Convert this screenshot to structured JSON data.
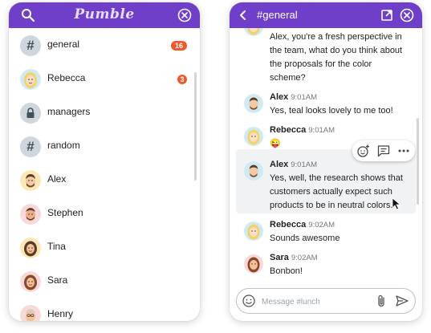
{
  "left_panel": {
    "logo": "Pumble",
    "icons": {
      "search": "search-icon",
      "close": "close-circle-icon"
    },
    "rows": [
      {
        "label": "general",
        "type": "channel",
        "icon": "hash-icon",
        "badge": "16"
      },
      {
        "label": "Rebecca",
        "type": "dm",
        "icon": "avatar-rebecca",
        "badge": "3"
      },
      {
        "label": "managers",
        "type": "channel",
        "icon": "lock-icon",
        "badge": ""
      },
      {
        "label": "random",
        "type": "channel",
        "icon": "hash-icon",
        "badge": ""
      },
      {
        "label": "Alex",
        "type": "dm",
        "icon": "avatar-alex",
        "badge": ""
      },
      {
        "label": "Stephen",
        "type": "dm",
        "icon": "avatar-stephen",
        "badge": ""
      },
      {
        "label": "Tina",
        "type": "dm",
        "icon": "avatar-tina",
        "badge": ""
      },
      {
        "label": "Sara",
        "type": "dm",
        "icon": "avatar-sara",
        "badge": ""
      },
      {
        "label": "Henry",
        "type": "dm",
        "icon": "avatar-henry",
        "badge": ""
      }
    ]
  },
  "chat": {
    "title": "#general",
    "icons": {
      "back": "chevron-left-icon",
      "popout": "popout-icon",
      "close": "close-circle-icon"
    },
    "messages": [
      {
        "author": "",
        "time": "",
        "lines": [
          "Alex, you're a fresh perspective in",
          "the team, what do you think about",
          "the proposals for the color",
          "scheme?"
        ]
      },
      {
        "author": "Alex",
        "time": "9:01AM",
        "lines": [
          "Yes, teal looks lovely to me too!"
        ]
      },
      {
        "author": "Rebecca",
        "time": "9:01AM",
        "lines": [
          "😜"
        ]
      },
      {
        "author": "Alex",
        "time": "9:01AM",
        "lines": [
          "Yes, well, the research shows that",
          "customers actually expect such",
          "products to be in neutral colors."
        ]
      },
      {
        "author": "Rebecca",
        "time": "9:02AM",
        "lines": [
          "Sounds awesome"
        ]
      },
      {
        "author": "Sara",
        "time": "9:02AM",
        "lines": [
          "Bonbon!"
        ]
      }
    ],
    "hover_actions": [
      "add-reaction-icon",
      "reply-thread-icon",
      "more-icon"
    ],
    "composer": {
      "placeholder": "Message #lunch",
      "icons": [
        "emoji-icon",
        "attach-icon",
        "send-icon"
      ]
    }
  },
  "colors": {
    "header": "#6f3fc9",
    "badge": "#ef5a2c",
    "highlight": "#f0f2f4"
  }
}
